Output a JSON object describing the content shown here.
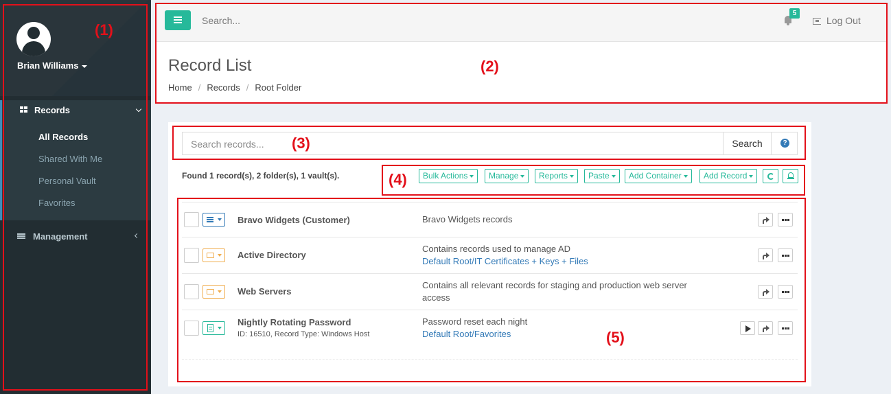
{
  "sidebar": {
    "user_name": "Brian Williams",
    "records_label": "Records",
    "sub_items": [
      "All Records",
      "Shared With Me",
      "Personal Vault",
      "Favorites"
    ],
    "active_item": "All Records",
    "management_label": "Management"
  },
  "topbar": {
    "search_placeholder": "Search...",
    "notification_count": "5",
    "logout_label": "Log Out"
  },
  "header": {
    "title": "Record List",
    "breadcrumb": [
      "Home",
      "Records",
      "Root Folder"
    ]
  },
  "search": {
    "placeholder": "Search records...",
    "button_label": "Search",
    "help_glyph": "?"
  },
  "summary": "Found 1 record(s), 2 folder(s), 1 vault(s).",
  "actions": [
    "Bulk Actions",
    "Manage",
    "Reports",
    "Paste",
    "Add Container",
    "Add Record"
  ],
  "records": [
    {
      "name": "Bravo Widgets (Customer)",
      "type_icon": "list-icon",
      "description": "Bravo Widgets records",
      "link": "",
      "subtext": ""
    },
    {
      "name": "Active Directory",
      "type_icon": "folder-icon",
      "description": "Contains records used to manage AD",
      "link": "Default Root/IT Certificates + Keys + Files",
      "subtext": ""
    },
    {
      "name": "Web Servers",
      "type_icon": "folder-icon",
      "description": "Contains all relevant records for staging and production web server access",
      "link": "",
      "subtext": ""
    },
    {
      "name": "Nightly Rotating Password",
      "type_icon": "document-icon",
      "description": "Password reset each night",
      "link": "Default Root/Favorites",
      "subtext": "ID: 16510, Record Type: Windows Host"
    }
  ],
  "annotations": [
    "(1)",
    "(2)",
    "(3)",
    "(4)",
    "(5)"
  ],
  "colors": {
    "sidebar_bg": "#222d32",
    "accent": "#26b99a",
    "link": "#337ab7",
    "annotation": "#e3101a"
  }
}
